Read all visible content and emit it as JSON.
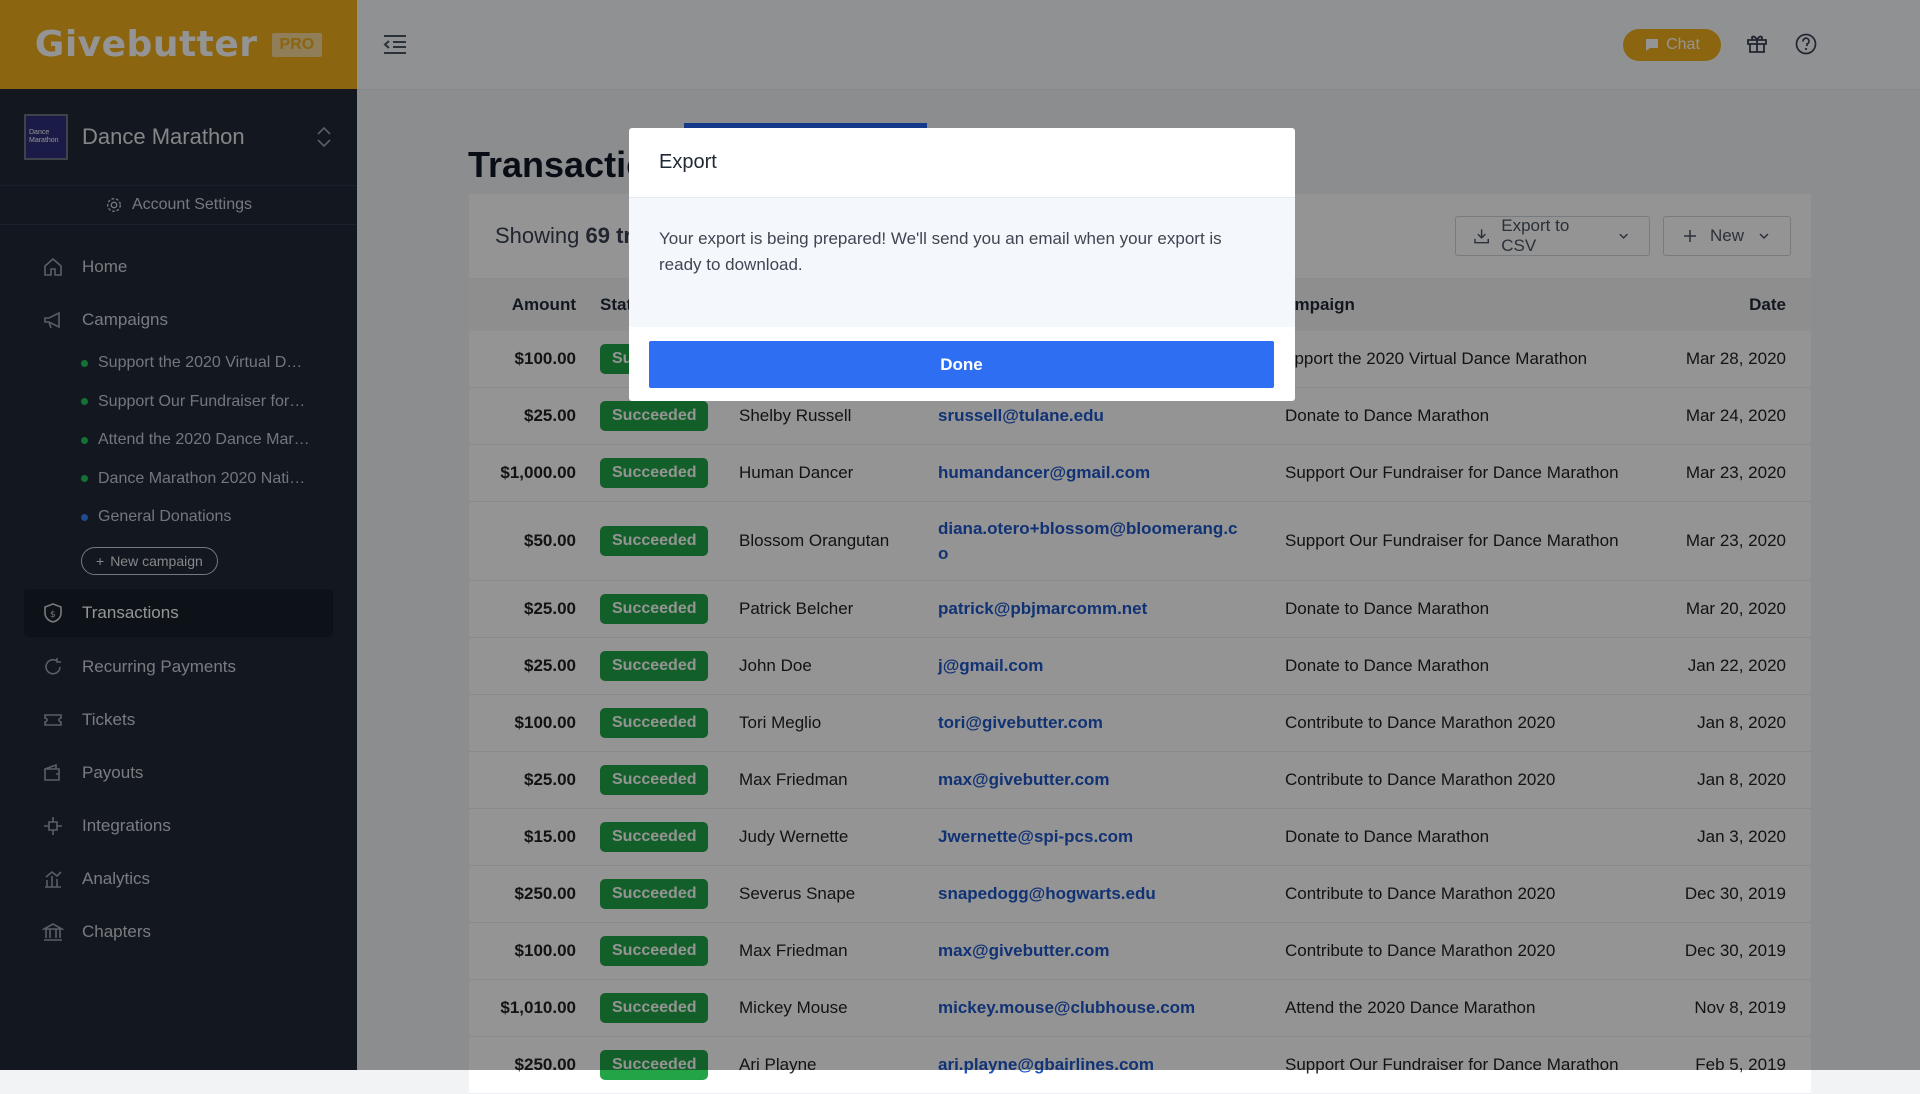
{
  "brand": {
    "name": "Givebutter",
    "badge": "PRO",
    "color": "#f0ae1c"
  },
  "org": {
    "name": "Dance Marathon",
    "logo_text": "Dance Marathon"
  },
  "account_settings": "Account Settings",
  "nav": {
    "home": "Home",
    "campaigns": "Campaigns",
    "campaign_items": [
      {
        "label": "Support the 2020 Virtual D…",
        "status": "active"
      },
      {
        "label": "Support Our Fundraiser for…",
        "status": "active"
      },
      {
        "label": "Attend the 2020 Dance Mar…",
        "status": "active"
      },
      {
        "label": "Dance Marathon 2020 Nati…",
        "status": "active"
      },
      {
        "label": "General Donations",
        "status": "general"
      }
    ],
    "new_campaign": "New campaign",
    "transactions": "Transactions",
    "recurring": "Recurring Payments",
    "tickets": "Tickets",
    "payouts": "Payouts",
    "integrations": "Integrations",
    "analytics": "Analytics",
    "chapters": "Chapters"
  },
  "topbar": {
    "chat": "Chat"
  },
  "page": {
    "title": "Transactio",
    "showing_prefix": "Showing ",
    "showing_count": "69 tr",
    "export_btn": "Export to CSV",
    "new_btn": "New"
  },
  "table": {
    "headers": {
      "amount": "Amount",
      "status": "Stat",
      "campaign": "ampaign",
      "date": "Date"
    },
    "rows": [
      {
        "amount": "$100.00",
        "status": "Su",
        "name": "",
        "email": "",
        "campaign": "upport the 2020 Virtual Dance Marathon",
        "date": "Mar 28, 2020"
      },
      {
        "amount": "$25.00",
        "status": "Succeeded",
        "name": "Shelby Russell",
        "email": "srussell@tulane.edu",
        "campaign": "Donate to Dance Marathon",
        "date": "Mar 24, 2020"
      },
      {
        "amount": "$1,000.00",
        "status": "Succeeded",
        "name": "Human Dancer",
        "email": "humandancer@gmail.com",
        "campaign": "Support Our Fundraiser for Dance Marathon",
        "date": "Mar 23, 2020"
      },
      {
        "amount": "$50.00",
        "status": "Succeeded",
        "name": "Blossom Orangutan",
        "email": "diana.otero+blossom@bloomerang.co",
        "campaign": "Support Our Fundraiser for Dance Marathon",
        "date": "Mar 23, 2020"
      },
      {
        "amount": "$25.00",
        "status": "Succeeded",
        "name": "Patrick Belcher",
        "email": "patrick@pbjmarcomm.net",
        "campaign": "Donate to Dance Marathon",
        "date": "Mar 20, 2020"
      },
      {
        "amount": "$25.00",
        "status": "Succeeded",
        "name": "John Doe",
        "email": "j@gmail.com",
        "campaign": "Donate to Dance Marathon",
        "date": "Jan 22, 2020"
      },
      {
        "amount": "$100.00",
        "status": "Succeeded",
        "name": "Tori Meglio",
        "email": "tori@givebutter.com",
        "campaign": "Contribute to Dance Marathon 2020",
        "date": "Jan 8, 2020"
      },
      {
        "amount": "$25.00",
        "status": "Succeeded",
        "name": "Max Friedman",
        "email": "max@givebutter.com",
        "campaign": "Contribute to Dance Marathon 2020",
        "date": "Jan 8, 2020"
      },
      {
        "amount": "$15.00",
        "status": "Succeeded",
        "name": "Judy Wernette",
        "email": "Jwernette@spi-pcs.com",
        "campaign": "Donate to Dance Marathon",
        "date": "Jan 3, 2020"
      },
      {
        "amount": "$250.00",
        "status": "Succeeded",
        "name": "Severus Snape",
        "email": "snapedogg@hogwarts.edu",
        "campaign": "Contribute to Dance Marathon 2020",
        "date": "Dec 30, 2019"
      },
      {
        "amount": "$100.00",
        "status": "Succeeded",
        "name": "Max Friedman",
        "email": "max@givebutter.com",
        "campaign": "Contribute to Dance Marathon 2020",
        "date": "Dec 30, 2019"
      },
      {
        "amount": "$1,010.00",
        "status": "Succeeded",
        "name": "Mickey Mouse",
        "email": "mickey.mouse@clubhouse.com",
        "campaign": "Attend the 2020 Dance Marathon",
        "date": "Nov 8, 2019"
      },
      {
        "amount": "$250.00",
        "status": "Succeeded",
        "name": "Ari Playne",
        "email": "ari.playne@gbairlines.com",
        "campaign": "Support Our Fundraiser for Dance Marathon",
        "date": "Feb 5, 2019"
      }
    ]
  },
  "modal": {
    "title": "Export",
    "message": "Your export is being prepared! We'll send you an email when your export is ready to download.",
    "done": "Done"
  },
  "colors": {
    "primary_blue": "#2e6ef2",
    "success_green": "#22a447",
    "sidebar_bg": "#1f2937"
  }
}
